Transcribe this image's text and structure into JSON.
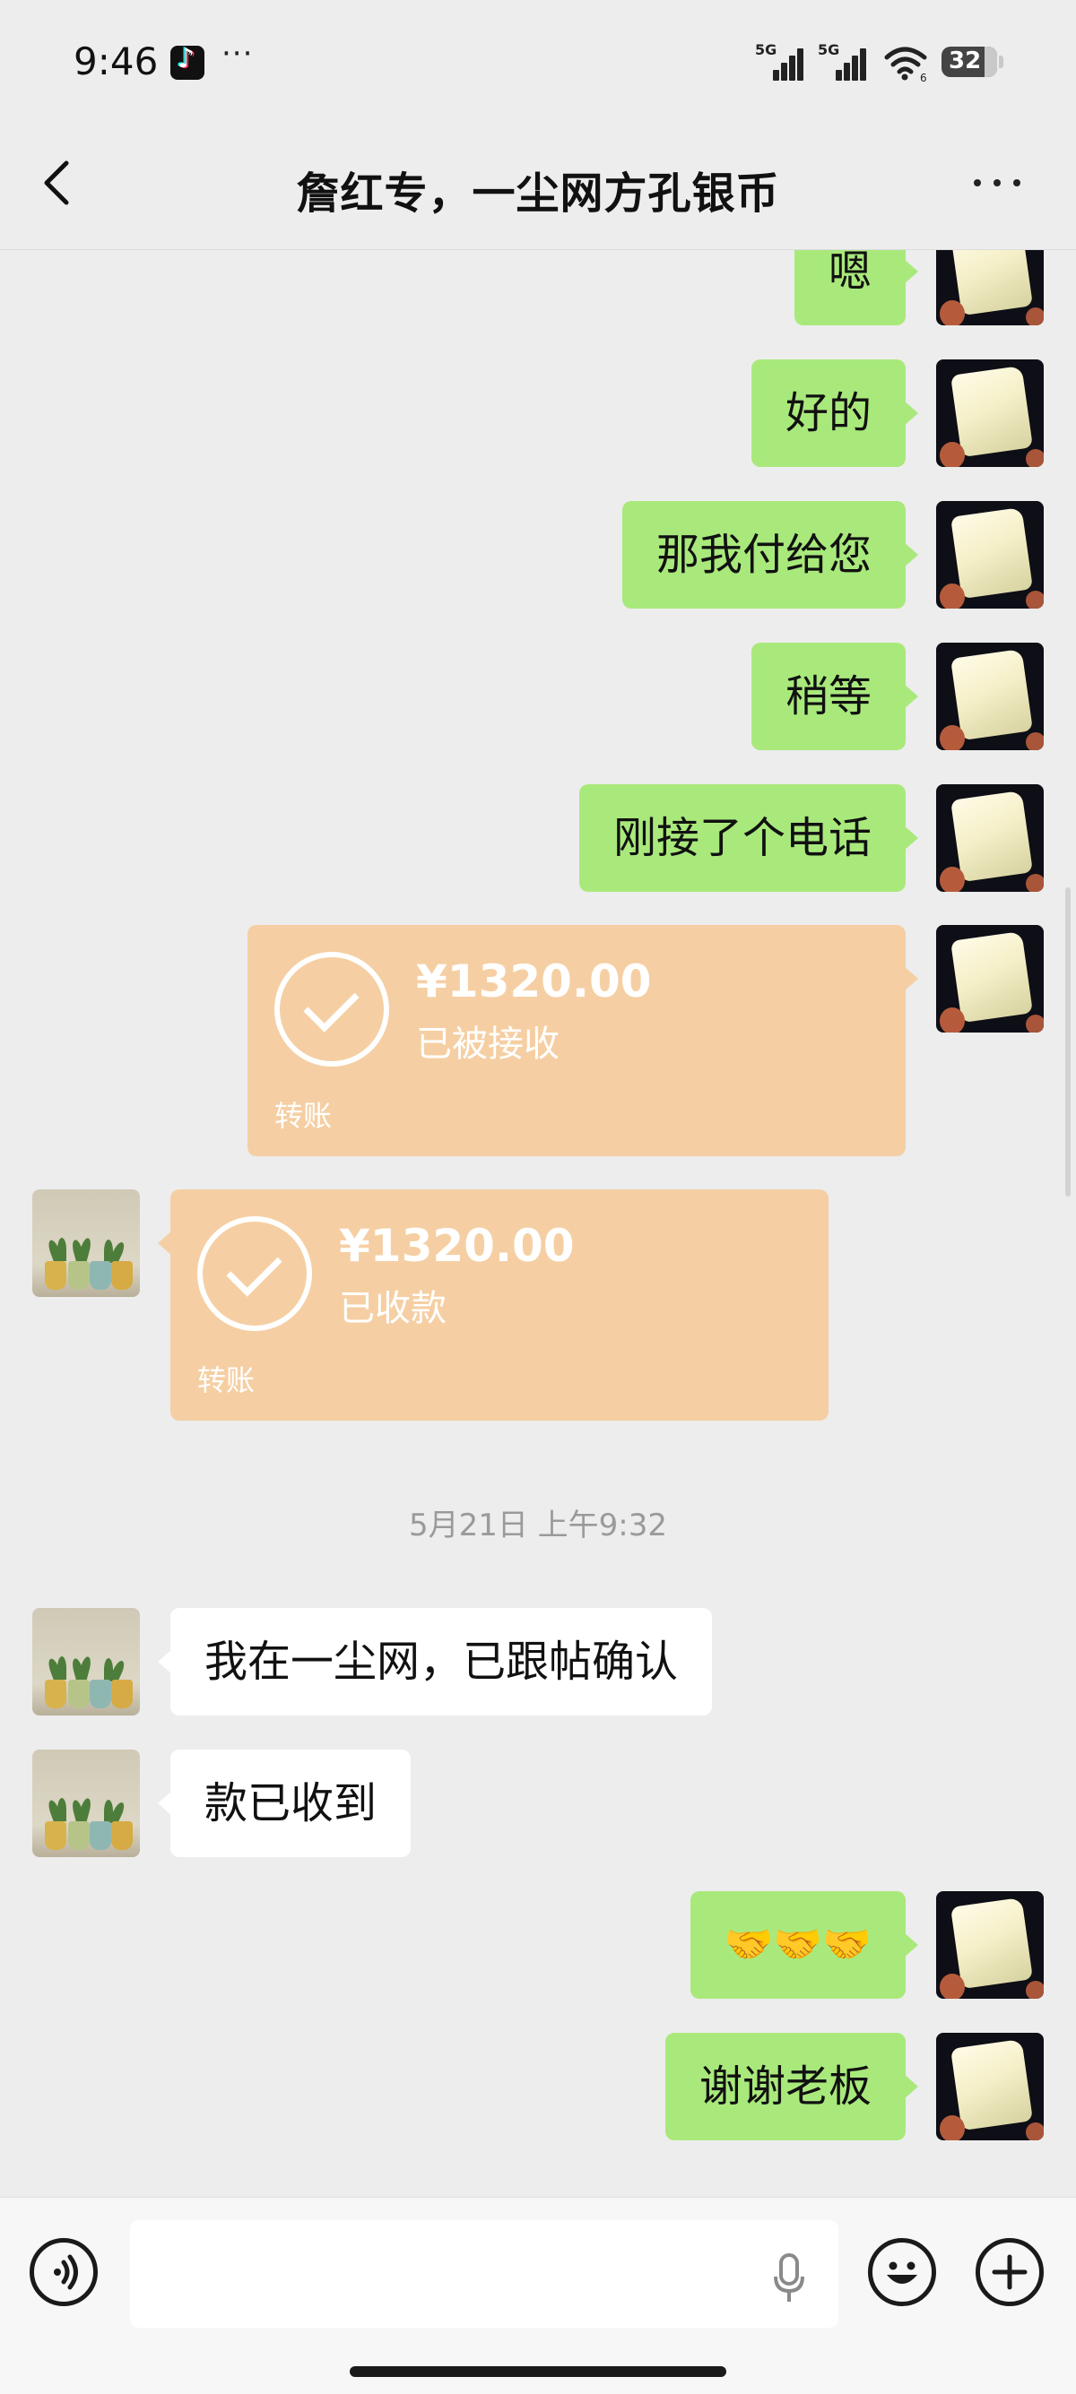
{
  "status_bar": {
    "time": "9:46",
    "more": "···",
    "net1": "5G",
    "net2": "5G",
    "wifi_sub": "6",
    "battery": "32"
  },
  "header": {
    "title": "詹红专，一尘网方孔银币"
  },
  "messages": [
    {
      "side": "me",
      "text": "嗯"
    },
    {
      "side": "me",
      "text": "好的"
    },
    {
      "side": "me",
      "text": "那我付给您"
    },
    {
      "side": "me",
      "text": "稍等"
    },
    {
      "side": "me",
      "text": "刚接了个电话"
    },
    {
      "side": "me",
      "type": "transfer",
      "amount": "¥1320.00",
      "status": "已被接收",
      "kind": "转账"
    },
    {
      "side": "them",
      "type": "transfer",
      "amount": "¥1320.00",
      "status": "已收款",
      "kind": "转账"
    },
    {
      "type": "timestamp",
      "text": "5月21日 上午9:32"
    },
    {
      "side": "them",
      "text": "我在一尘网，已跟帖确认"
    },
    {
      "side": "them",
      "text": "款已收到"
    },
    {
      "side": "me",
      "text": "🤝🤝🤝"
    },
    {
      "side": "me",
      "text": "谢谢老板"
    }
  ],
  "input": {
    "value": "",
    "placeholder": ""
  },
  "colors": {
    "background": "#ededed",
    "my_bubble": "#a9e97c",
    "their_bubble": "#ffffff",
    "transfer": "#f5cfa3",
    "timestamp": "#9a9a9a"
  },
  "icons": [
    "tiktok-icon",
    "signal-icon",
    "wifi-icon",
    "battery-icon",
    "back-chevron-icon",
    "more-dots-icon",
    "voice-icon",
    "microphone-icon",
    "emoji-icon",
    "plus-icon",
    "check-circle-icon"
  ]
}
